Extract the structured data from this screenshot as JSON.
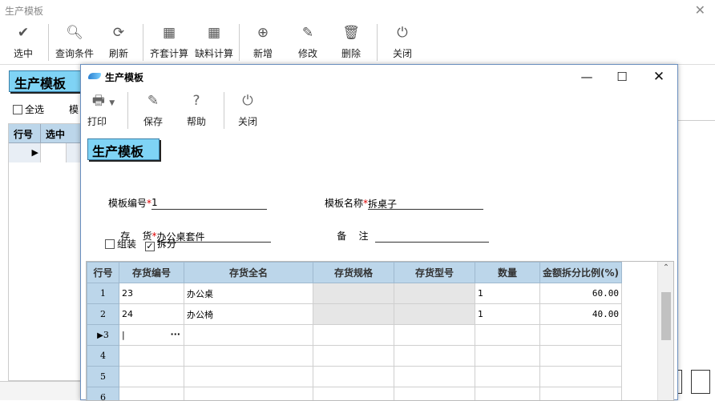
{
  "bg": {
    "title": "生产模板",
    "toolbar": [
      {
        "icon": "check-circle-icon",
        "label": "选中"
      },
      {
        "icon": "search-icon",
        "label": "查询条件"
      },
      {
        "icon": "refresh-icon",
        "label": "刷新"
      },
      {
        "icon": "calculator-icon",
        "label": "齐套计算"
      },
      {
        "icon": "calculator-icon",
        "label": "缺料计算"
      },
      {
        "icon": "plus-circle-icon",
        "label": "新增"
      },
      {
        "icon": "edit-icon",
        "label": "修改"
      },
      {
        "icon": "trash-icon",
        "label": "删除"
      },
      {
        "icon": "power-icon",
        "label": "关闭"
      }
    ],
    "heading": "生产模板",
    "select_all": "全选",
    "partial_label": "模",
    "grid_headers": [
      "行号",
      "选中"
    ]
  },
  "dialog": {
    "title": "生产模板",
    "toolbar": [
      {
        "icon": "printer-icon",
        "label": "打印"
      },
      {
        "icon": "pen-icon",
        "label": "保存"
      },
      {
        "icon": "help-icon",
        "label": "帮助"
      },
      {
        "icon": "power-icon",
        "label": "关闭"
      }
    ],
    "heading": "生产模板",
    "form": {
      "template_no_label": "模板编号",
      "template_no_value": "1",
      "template_name_label": "模板名称",
      "template_name_value": "拆桌子",
      "inventory_label": "存    货",
      "inventory_value": "办公桌套件",
      "remark_label": "备    注",
      "remark_value": "",
      "assemble_label": "组装",
      "assemble_checked": false,
      "split_label": "拆分",
      "split_checked": true
    },
    "grid": {
      "headers": [
        "行号",
        "存货编号",
        "存货全名",
        "存货规格",
        "存货型号",
        "数量",
        "金额拆分比例(%)"
      ],
      "rows": [
        {
          "no": "1",
          "code": "23",
          "name": "办公桌",
          "spec": "",
          "model": "",
          "qty": "1",
          "ratio": "60.00"
        },
        {
          "no": "2",
          "code": "24",
          "name": "办公椅",
          "spec": "",
          "model": "",
          "qty": "1",
          "ratio": "40.00"
        },
        {
          "no": "3",
          "code": "",
          "name": "",
          "spec": "",
          "model": "",
          "qty": "",
          "ratio": ""
        },
        {
          "no": "4",
          "code": "",
          "name": "",
          "spec": "",
          "model": "",
          "qty": "",
          "ratio": ""
        },
        {
          "no": "5",
          "code": "",
          "name": "",
          "spec": "",
          "model": "",
          "qty": "",
          "ratio": ""
        },
        {
          "no": "6",
          "code": "",
          "name": "",
          "spec": "",
          "model": "",
          "qty": "",
          "ratio": ""
        }
      ],
      "ellipsis": "···"
    }
  }
}
